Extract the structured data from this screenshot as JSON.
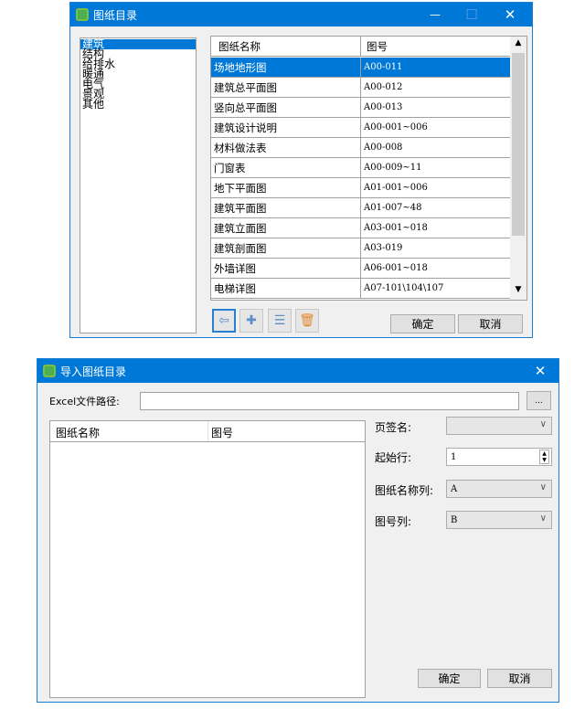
{
  "dialog1": {
    "title": "图纸目录",
    "minimize": "—",
    "maximize": "☐",
    "close": "✕",
    "categories": [
      "建筑",
      "结构",
      "给排水",
      "暖通",
      "电气",
      "景观",
      "其他"
    ],
    "selected_category": 0,
    "columns": [
      "图纸名称",
      "图号"
    ],
    "rows": [
      [
        "场地地形图",
        "A00-011"
      ],
      [
        "建筑总平面图",
        "A00-012"
      ],
      [
        "竖向总平面图",
        "A00-013"
      ],
      [
        "建筑设计说明",
        "A00-001~006"
      ],
      [
        "材料做法表",
        "A00-008"
      ],
      [
        "门窗表",
        "A00-009~11"
      ],
      [
        "地下平面图",
        "A01-001~006"
      ],
      [
        "建筑平面图",
        "A01-007~48"
      ],
      [
        "建筑立面图",
        "A03-001~018"
      ],
      [
        "建筑剖面图",
        "A03-019"
      ],
      [
        "外墙详图",
        "A06-001~018"
      ],
      [
        "电梯详图",
        "A07-101\\104\\107"
      ]
    ],
    "selected_row": 0,
    "tool_icons": [
      "import-folder-icon",
      "add-file-icon",
      "list-icon",
      "delete-icon"
    ],
    "ok": "确定",
    "cancel": "取消"
  },
  "dialog2": {
    "title": "导入图纸目录",
    "close": "✕",
    "path_label": "Excel文件路径:",
    "path_value": "",
    "browse": "...",
    "columns": [
      "图纸名称",
      "图号"
    ],
    "sheet_label": "页签名:",
    "sheet_value": "",
    "start_row_label": "起始行:",
    "start_row_value": "1",
    "name_col_label": "图纸名称列:",
    "name_col_value": "A",
    "num_col_label": "图号列:",
    "num_col_value": "B",
    "ok": "确定",
    "cancel": "取消"
  },
  "colors": {
    "titlebar": "#0078d7",
    "selection": "#0078d7",
    "window_bg": "#f0f0f0"
  }
}
